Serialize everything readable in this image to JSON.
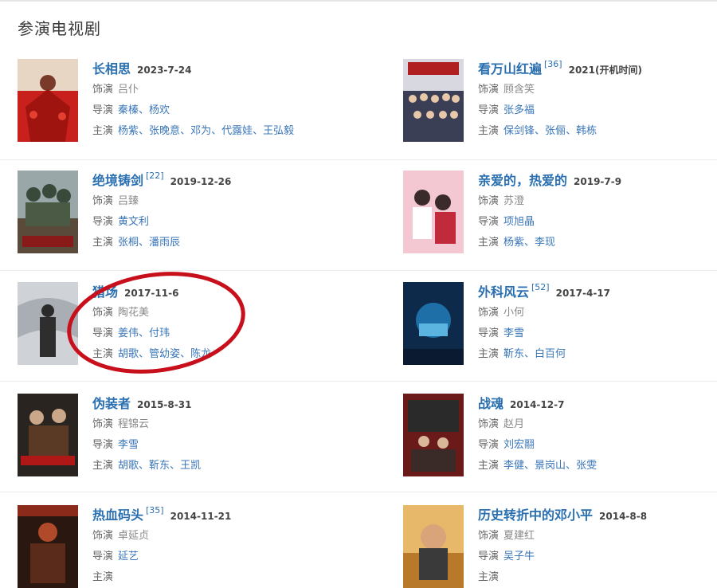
{
  "section_title": "参演电视剧",
  "colors": {
    "title_link": "#2a6fb0",
    "circle": "#c8101c"
  },
  "dramas": [
    {
      "title": "长相思",
      "badge": "",
      "date": "2023-7-24",
      "role_label": "饰演",
      "role": "吕仆",
      "director_label": "导演",
      "directors": [
        "秦榛",
        "杨欢"
      ],
      "cast_label": "主演",
      "cast": [
        "杨紫",
        "张晚意",
        "邓为",
        "代露娃",
        "王弘毅"
      ],
      "poster_icon": "poster-red-crowd"
    },
    {
      "title": "看万山红遍",
      "badge": "[36]",
      "date": "2021(开机时间)",
      "role_label": "饰演",
      "role": "顾含笑",
      "director_label": "导演",
      "directors": [
        "张多福"
      ],
      "cast_label": "主演",
      "cast": [
        "保剑锋",
        "张俪",
        "韩栋"
      ],
      "poster_icon": "poster-group-photo"
    },
    {
      "title": "绝境铸剑",
      "badge": "[22]",
      "date": "2019-12-26",
      "role_label": "饰演",
      "role": "吕臻",
      "director_label": "导演",
      "directors": [
        "黄文利"
      ],
      "cast_label": "主演",
      "cast": [
        "张桐",
        "潘雨辰"
      ],
      "poster_icon": "poster-soldiers"
    },
    {
      "title": "亲爱的，热爱的",
      "badge": "",
      "date": "2019-7-9",
      "role_label": "饰演",
      "role": "苏澄",
      "director_label": "导演",
      "directors": [
        "项旭晶"
      ],
      "cast_label": "主演",
      "cast": [
        "杨紫",
        "李现"
      ],
      "poster_icon": "poster-couple-pink"
    },
    {
      "title": "猎场",
      "badge": "",
      "date": "2017-11-6",
      "role_label": "饰演",
      "role": "陶花美",
      "director_label": "导演",
      "directors": [
        "姜伟",
        "付玮"
      ],
      "cast_label": "主演",
      "cast": [
        "胡歌",
        "管幼姿",
        "陈龙"
      ],
      "poster_icon": "poster-gray-wings"
    },
    {
      "title": "外科风云",
      "badge": "[52]",
      "date": "2017-4-17",
      "role_label": "饰演",
      "role": "小何",
      "director_label": "导演",
      "directors": [
        "李雪"
      ],
      "cast_label": "主演",
      "cast": [
        "靳东",
        "白百何"
      ],
      "poster_icon": "poster-surgeon-blue"
    },
    {
      "title": "伪装者",
      "badge": "",
      "date": "2015-8-31",
      "role_label": "饰演",
      "role": "程锦云",
      "director_label": "导演",
      "directors": [
        "李雪"
      ],
      "cast_label": "主演",
      "cast": [
        "胡歌",
        "靳东",
        "王凯"
      ],
      "poster_icon": "poster-disguiser"
    },
    {
      "title": "战魂",
      "badge": "",
      "date": "2014-12-7",
      "role_label": "饰演",
      "role": "赵月",
      "director_label": "导演",
      "directors": [
        "刘宏翮"
      ],
      "cast_label": "主演",
      "cast": [
        "李健",
        "景岗山",
        "张雯"
      ],
      "poster_icon": "poster-war-red"
    },
    {
      "title": "热血码头",
      "badge": "[35]",
      "date": "2014-11-21",
      "role_label": "饰演",
      "role": "卓延贞",
      "director_label": "导演",
      "directors": [
        "延艺"
      ],
      "cast_label": "主演",
      "cast": [],
      "poster_icon": "poster-dock-red"
    },
    {
      "title": "历史转折中的邓小平",
      "badge": "",
      "date": "2014-8-8",
      "role_label": "饰演",
      "role": "夏建红",
      "director_label": "导演",
      "directors": [
        "吴子牛"
      ],
      "cast_label": "主演",
      "cast": [],
      "poster_icon": "poster-portrait-gold"
    }
  ]
}
